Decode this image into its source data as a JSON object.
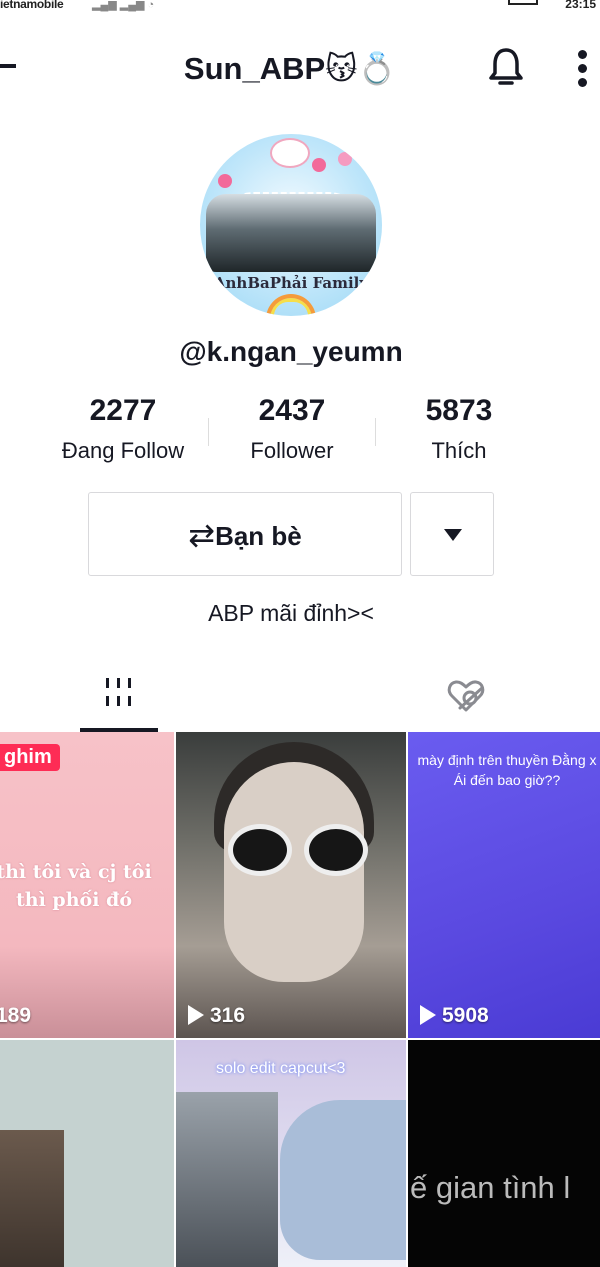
{
  "status_bar": {
    "carrier": "ietnamobile",
    "time": "23:15"
  },
  "header": {
    "title": "Sun_ABP😽💍"
  },
  "profile": {
    "avatar_text": "AnhBaPhải Family",
    "handle": "@k.ngan_yeumn",
    "stats": [
      {
        "value": "2277",
        "label": "Đang Follow"
      },
      {
        "value": "2437",
        "label": "Follower"
      },
      {
        "value": "5873",
        "label": "Thích"
      }
    ],
    "friends_button": {
      "icon": "⇄",
      "label": "Bạn bè"
    },
    "bio": "ABP mãi đỉnh><"
  },
  "tabs": [
    {
      "name": "videos",
      "icon": "grid-icon",
      "active": true
    },
    {
      "name": "liked",
      "icon": "hidden-heart-icon",
      "active": false
    }
  ],
  "videos": [
    {
      "badge": "ghim",
      "caption": "thì tôi và cj tôi thì phối đó",
      "views": "189"
    },
    {
      "caption": "",
      "views": "316"
    },
    {
      "caption": "mày định trên thuyền Đằng x Ái đến bao giờ??",
      "views": "5908"
    },
    {
      "caption": "",
      "views": ""
    },
    {
      "caption": "solo edit capcut<3",
      "views": ""
    },
    {
      "caption": "ế gian tình l",
      "views": ""
    }
  ],
  "colors": {
    "accent": "#fe2c55",
    "text": "#161823",
    "border": "#d9d9dc"
  }
}
